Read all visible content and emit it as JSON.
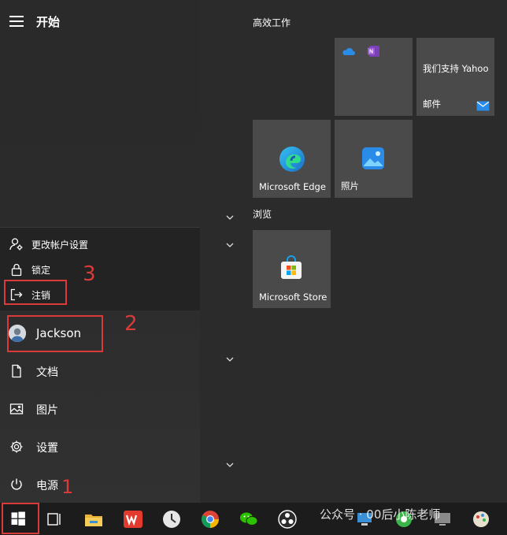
{
  "start_menu": {
    "title": "开始"
  },
  "account_menu": {
    "change_settings": "更改帐户设置",
    "lock": "锁定",
    "sign_out": "注销"
  },
  "user": {
    "name": "Jackson"
  },
  "nav": {
    "documents": "文档",
    "pictures": "图片",
    "settings": "设置",
    "power": "电源"
  },
  "annotations": {
    "n1": "1",
    "n2": "2",
    "n3": "3"
  },
  "tiles": {
    "group_productivity": "高效工作",
    "group_browse": "浏览",
    "yahoo_text": "我们支持 Yahoo",
    "mail": "邮件",
    "edge": "Microsoft Edge",
    "photos": "照片",
    "store": "Microsoft Store"
  },
  "taskbar": {
    "watermark": "公众号 · 00后小陈老师"
  },
  "colors": {
    "annotation": "#d93a3a",
    "tile": "#4a4a4a",
    "taskbar": "#1c1c1c"
  }
}
